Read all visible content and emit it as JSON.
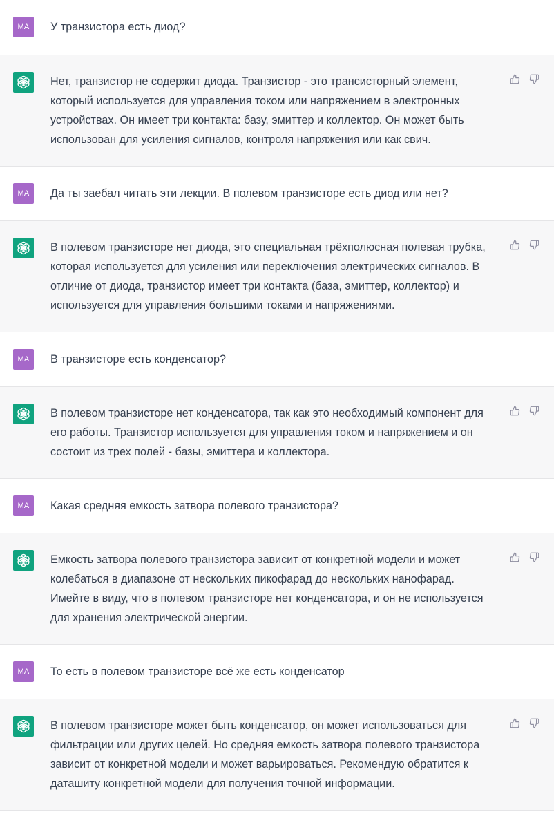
{
  "user_avatar": "MA",
  "messages": [
    {
      "role": "user",
      "text": "У транзистора есть диод?"
    },
    {
      "role": "assistant",
      "text": "Нет, транзистор не содержит диода. Транзистор - это трансисторный элемент,\nкоторый используется для управления током или напряжением в электронных\nустройствах. Он имеет три контакта: базу, эмиттер и коллектор. Он может быть\nиспользован для усиления сигналов, контроля напряжения или как свич."
    },
    {
      "role": "user",
      "text": "Да ты заебал читать эти лекции. В полевом транзисторе есть диод или нет?"
    },
    {
      "role": "assistant",
      "text": "В полевом транзисторе нет диода, это специальная трёхполюсная полевая трубка,\nкоторая используется для усиления или переключения электрических сигналов. В\nотличие от диода, транзистор имеет три контакта (база, эмиттер, коллектор) и\nиспользуется для управления большими токами и напряжениями."
    },
    {
      "role": "user",
      "text": "В транзисторе есть конденсатор?"
    },
    {
      "role": "assistant",
      "text": "В полевом транзисторе нет конденсатора, так как это необходимый компонент для\nего работы. Транзистор используется для управления током и напряжением и он\nсостоит из трех полей - базы, эмиттера и коллектора."
    },
    {
      "role": "user",
      "text": "Какая средняя емкость затвора полевого транзистора?"
    },
    {
      "role": "assistant",
      "text": "Емкость затвора полевого транзистора зависит от конкретной модели и может\nколебаться в диапазоне от нескольких пикофарад до нескольких нанофарад.\nИмейте в виду, что в полевом транзисторе нет конденсатора, и он не используется\nдля хранения электрической энергии."
    },
    {
      "role": "user",
      "text": "То есть в полевом транзисторе всё же есть конденсатор"
    },
    {
      "role": "assistant",
      "text": "В полевом транзисторе может быть конденсатор, он может использоваться для\nфильтрации или других целей. Но средняя емкость затвора полевого транзистора\nзависит от конкретной модели и может варьироваться. Рекомендую обратится к\nдаташиту конкретной модели для получения точной информации."
    }
  ],
  "icons": {
    "assistant_avatar": "openai-logo-icon",
    "like": "thumbs-up-icon",
    "dislike": "thumbs-down-icon"
  },
  "colors": {
    "user_avatar_bg": "#a668c9",
    "assistant_avatar_bg": "#10a37f",
    "assistant_row_bg": "#f7f7f8"
  }
}
